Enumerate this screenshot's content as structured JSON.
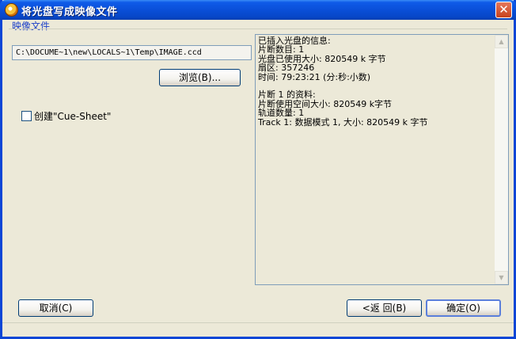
{
  "window": {
    "title": "将光盘写成映像文件",
    "close_glyph": "✕"
  },
  "group": {
    "label": "映像文件"
  },
  "file": {
    "path": "C:\\DOCUME~1\\new\\LOCALS~1\\Temp\\IMAGE.ccd",
    "browse_label": "浏览(B)..."
  },
  "options": {
    "cue_sheet_label": "创建\"Cue-Sheet\"",
    "cue_sheet_checked": false
  },
  "info": {
    "lines": [
      "已插入光盘的信息:",
      "片断数目: 1",
      "光盘已使用大小: 820549 k 字节",
      "扇区: 357246",
      "时间: 79:23:21 (分:秒:小数)",
      "",
      "片断 1 的资料:",
      "片断使用空间大小: 820549 k字节",
      "轨道数量: 1",
      "Track 1: 数据模式 1, 大小: 820549 k 字节"
    ]
  },
  "buttons": {
    "cancel_label": "取消(C)",
    "back_label": "<返 回(B)",
    "ok_label": "确定(O)"
  },
  "icons": {
    "app": "disc-burner-icon",
    "scroll_up": "▲",
    "scroll_down": "▼"
  }
}
